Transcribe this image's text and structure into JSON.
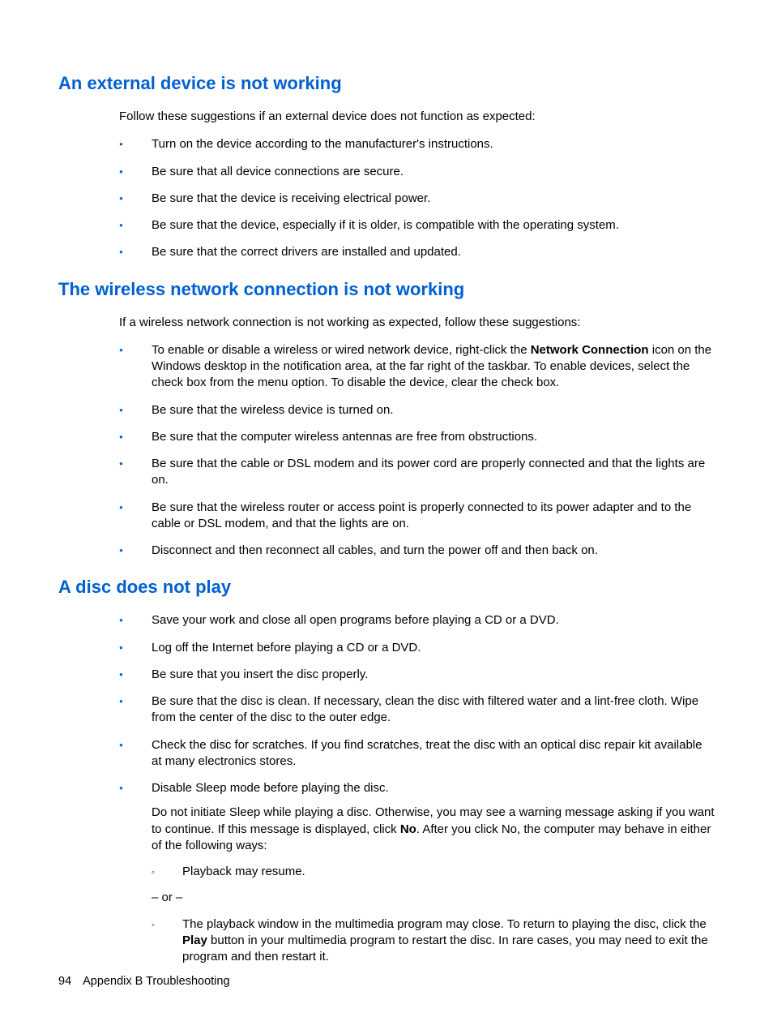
{
  "section1": {
    "heading": "An external device is not working",
    "intro": "Follow these suggestions if an external device does not function as expected:",
    "items": [
      "Turn on the device according to the manufacturer's instructions.",
      "Be sure that all device connections are secure.",
      "Be sure that the device is receiving electrical power.",
      "Be sure that the device, especially if it is older, is compatible with the operating system.",
      "Be sure that the correct drivers are installed and updated."
    ]
  },
  "section2": {
    "heading": "The wireless network connection is not working",
    "intro": "If a wireless network connection is not working as expected, follow these suggestions:",
    "item0_pre": "To enable or disable a wireless or wired network device, right-click the ",
    "item0_bold": "Network Connection",
    "item0_post": " icon on the Windows desktop in the notification area, at the far right of the taskbar. To enable devices, select the check box from the menu option. To disable the device, clear the check box.",
    "items_rest": [
      "Be sure that the wireless device is turned on.",
      "Be sure that the computer wireless antennas are free from obstructions.",
      "Be sure that the cable or DSL modem and its power cord are properly connected and that the lights are on.",
      "Be sure that the wireless router or access point is properly connected to its power adapter and to the cable or DSL modem, and that the lights are on.",
      "Disconnect and then reconnect all cables, and turn the power off and then back on."
    ]
  },
  "section3": {
    "heading": "A disc does not play",
    "items": [
      "Save your work and close all open programs before playing a CD or a DVD.",
      "Log off the Internet before playing a CD or a DVD.",
      "Be sure that you insert the disc properly.",
      "Be sure that the disc is clean. If necessary, clean the disc with filtered water and a lint-free cloth. Wipe from the center of the disc to the outer edge.",
      "Check the disc for scratches. If you find scratches, treat the disc with an optical disc repair kit available at many electronics stores."
    ],
    "last_main": "Disable Sleep mode before playing the disc.",
    "last_sub_pre": "Do not initiate Sleep while playing a disc. Otherwise, you may see a warning message asking if you want to continue. If this message is displayed, click ",
    "last_sub_bold": "No",
    "last_sub_post": ". After you click No, the computer may behave in either of the following ways:",
    "sublist0": "Playback may resume.",
    "or_text": "– or –",
    "sublist1_pre": "The playback window in the multimedia program may close. To return to playing the disc, click the ",
    "sublist1_bold": "Play",
    "sublist1_post": " button in your multimedia program to restart the disc. In rare cases, you may need to exit the program and then restart it."
  },
  "footer": {
    "page": "94",
    "appendix": "Appendix B   Troubleshooting"
  }
}
